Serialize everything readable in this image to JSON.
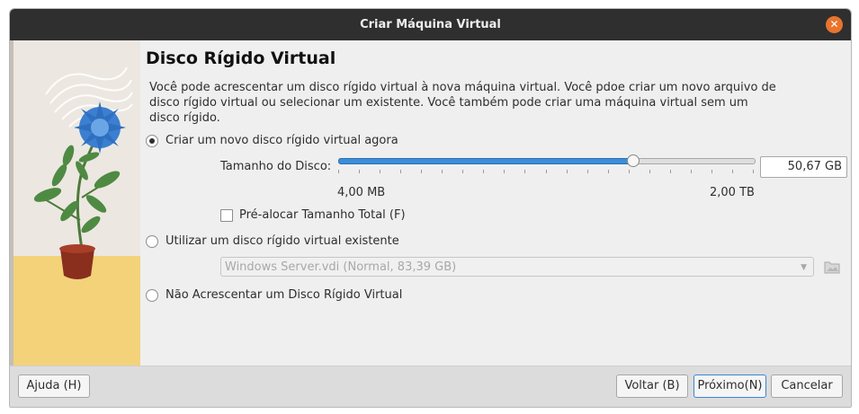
{
  "window": {
    "title": "Criar Máquina Virtual",
    "close_label": "✕"
  },
  "page": {
    "heading": "Disco Rígido Virtual",
    "description": "Você pode acrescentar um disco rígido virtual à nova máquina virtual. Você pdoe criar um novo arquivo de disco rígido virtual ou selecionar um existente. Você também pode criar uma máquina virtual sem um disco rígido."
  },
  "options": {
    "create_new": {
      "label": "Criar um novo disco rígido virtual agora",
      "checked": true
    },
    "use_existing": {
      "label": "Utilizar um disco rígido virtual existente",
      "checked": false
    },
    "no_disk": {
      "label": "Não Acrescentar um Disco Rígido Virtual",
      "checked": false
    }
  },
  "disk_size": {
    "label": "Tamanho do Disco:",
    "value": "50,67 GB",
    "min_label": "4,00 MB",
    "max_label": "2,00 TB",
    "slider_fraction": 0.71,
    "tick_count": 20
  },
  "preallocate": {
    "label": "Pré-alocar Tamanho Total (F)",
    "checked": false
  },
  "existing_disk": {
    "selected": "Windows Server.vdi (Normal, 83,39 GB)"
  },
  "buttons": {
    "help": "Ajuda (H)",
    "back": "Voltar (B)",
    "next": "Próximo(N)",
    "cancel": "Cancelar"
  },
  "colors": {
    "accent": "#3d8ed8",
    "close": "#e9742d",
    "titlebar": "#2f2f2f"
  }
}
